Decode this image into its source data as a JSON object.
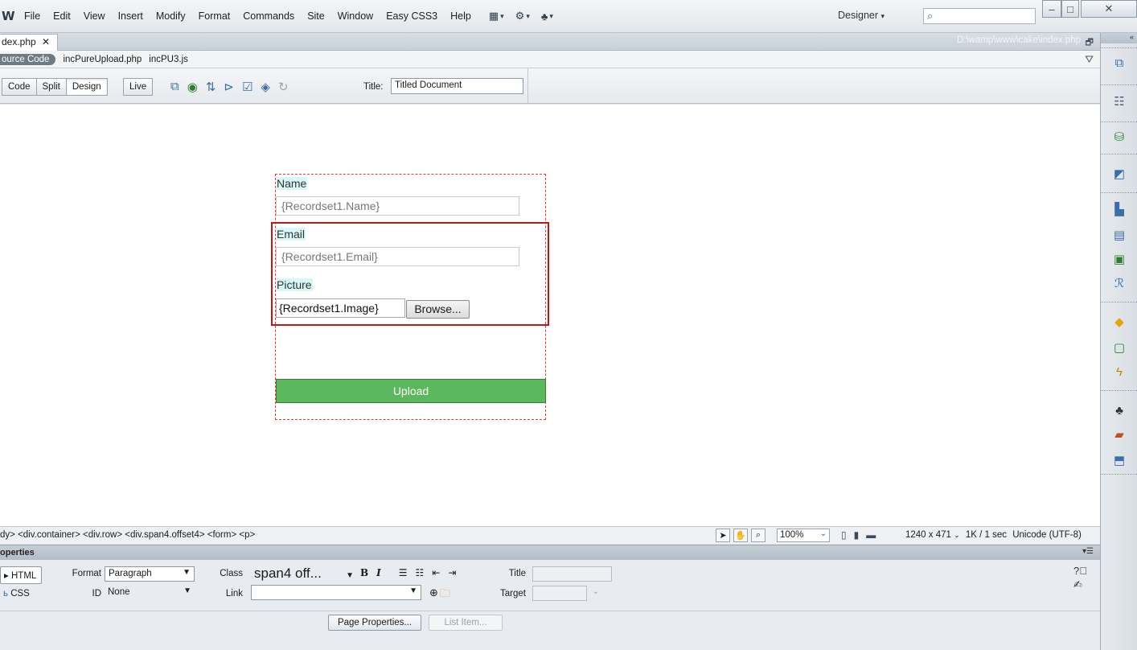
{
  "menubar": {
    "logo": "W",
    "items": [
      "File",
      "Edit",
      "View",
      "Insert",
      "Modify",
      "Format",
      "Commands",
      "Site",
      "Window",
      "Easy CSS3",
      "Help"
    ],
    "workspace": "Designer",
    "search_placeholder": ""
  },
  "doc": {
    "tab_label": "dex.php",
    "path": "D:\\wamp\\www\\cake\\index.php",
    "related_source": "ource Code",
    "related_files": [
      "incPureUpload.php",
      "incPU3.js"
    ]
  },
  "toolbar": {
    "views": [
      "Code",
      "Split",
      "Design"
    ],
    "active_view": "Design",
    "live_label": "Live",
    "title_label": "Title:",
    "title_value": "Titled Document"
  },
  "form": {
    "name_label": "Name",
    "name_value": "{Recordset1.Name}",
    "email_label": "Email",
    "email_value": "{Recordset1.Email}",
    "picture_label": "Picture",
    "image_value": "{Recordset1.Image}",
    "browse_label": "Browse...",
    "upload_label": "Upload",
    "upload_color": "#5cb85c"
  },
  "status": {
    "tag_path": "dy> <div.container> <div.row> <div.span4.offset4> <form> <p>",
    "zoom": "100%",
    "dimensions": "1240 x 471",
    "download": "1K / 1 sec",
    "encoding": "Unicode (UTF-8)"
  },
  "properties": {
    "title": "operties",
    "html_btn": "HTML",
    "css_btn": "CSS",
    "format_label": "Format",
    "format_value": "Paragraph",
    "id_label": "ID",
    "id_value": "None",
    "class_label": "Class",
    "class_value": "span4 off...",
    "link_label": "Link",
    "title_label": "Title",
    "target_label": "Target",
    "page_properties": "Page Properties...",
    "list_item": "List Item..."
  }
}
